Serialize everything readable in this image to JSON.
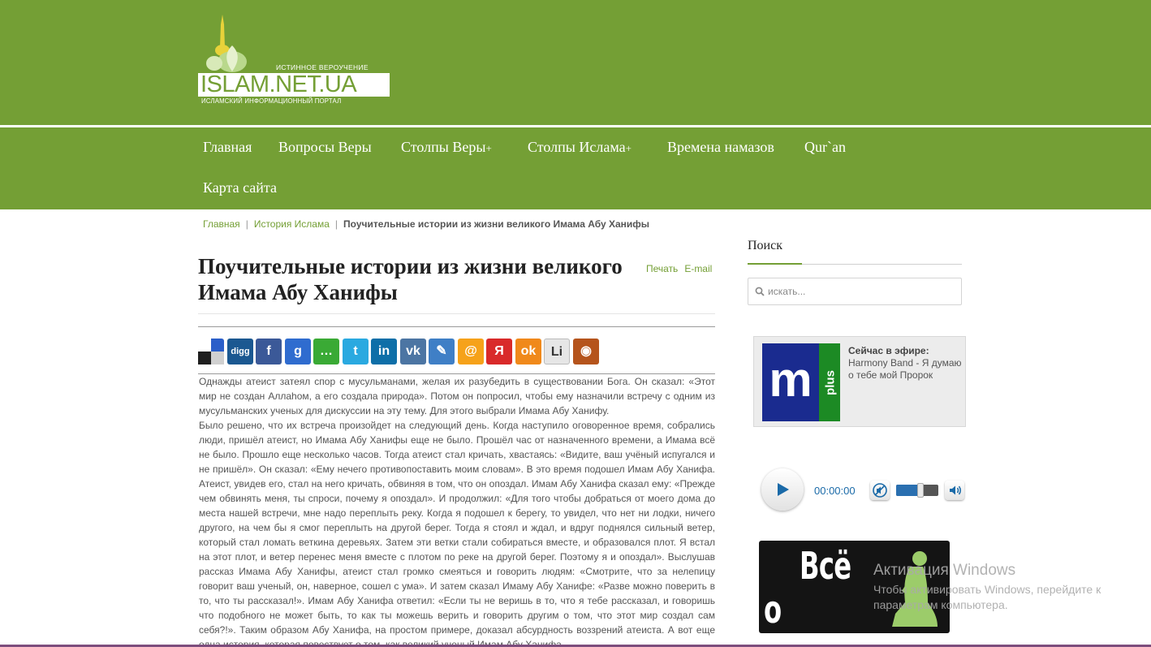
{
  "site": {
    "tagline": "ИСТИННОЕ ВЕРОУЧЕНИЕ",
    "name": "ISLAM.NET.UA",
    "subtitle": "ИСЛАМСКИЙ ИНФОРМАЦИОННЫЙ ПОРТАЛ"
  },
  "nav": {
    "items": [
      {
        "label": "Главная",
        "plus": ""
      },
      {
        "label": "Вопросы Веры",
        "plus": ""
      },
      {
        "label": "Столпы Веры",
        "plus": "+"
      },
      {
        "label": "Столпы Ислама",
        "plus": "+"
      },
      {
        "label": "Времена намазов",
        "plus": ""
      },
      {
        "label": "Qur`an",
        "plus": ""
      },
      {
        "label": "Карта сайта",
        "plus": ""
      }
    ]
  },
  "breadcrumb": {
    "home": "Главная",
    "section": "История Ислама",
    "separator": "|",
    "current": "Поучительные истории из жизни великого Имама Абу Ханифы"
  },
  "article": {
    "title": "Поучительные истории из жизни великого Имама Абу Ханифы",
    "print_label": "Печать",
    "email_label": "E-mail",
    "paragraphs": [
      "Однажды атеист затеял спор с мусульманами, желая их разубедить в существовании Бога. Он сказал: «Этот мир не создан Аллаhом, а его создала природа». Потом он попросил, чтобы ему назначили встречу с одним из мусульманских ученых для дискуссии на эту тему. Для этого выбрали Имама Абу Ханифу.",
      "Было решено, что их встреча произойдет на следующий день. Когда наступило оговоренное время, собрались люди, пришёл атеист, но Имама Абу Ханифы еще не было. Прошёл час от назначенного времени, а Имама всё не было. Прошло еще несколько часов. Тогда атеист стал кричать, хвастаясь: «Видите, ваш учёный испугался и не пришёл». Он сказал: «Ему нечего противопоставить моим словам». В это время подошел Имам Абу Ханифа. Атеист, увидев его, стал на него кричать, обвиняя в том, что он опоздал. Имам Абу Ханифа сказал ему: «Прежде чем обвинять меня, ты спроси, почему я опоздал». И продолжил: «Для того чтобы добраться от моего дома до места нашей встречи, мне надо переплыть реку. Когда я подошел к берегу, то увидел, что нет ни лодки, ничего другого, на чем бы я смог переплыть на другой берег. Тогда я стоял и ждал, и вдруг поднялся сильный ветер, который стал ломать веткина деревьях. Затем эти ветки стали собираться вместе, и образовался плот. Я встал на этот плот, и ветер перенес меня вместе с плотом по реке на другой берег. Поэтому я и опоздал». Выслушав рассказ Имама Абу Ханифы, атеист стал громко смеяться и говорить людям: «Смотрите, что за нелепицу говорит ваш ученый, он, наверное, сошел с ума». И затем сказал Имаму Абу Ханифе: «Разве можно поверить в то, что ты рассказал!». Имам Абу Ханифа ответил: «Если ты не веришь в то, что я тебе рассказал, и говоришь что подобного не может быть, то как ты можешь верить и говорить другим о том, что этот мир создал сам себя?!». Таким образом Абу Ханифа, на простом примере, доказал абсурдность воззрений атеиста. А вот еще одна история, которая повествует о том, как великий ученый Имам Абу Ханифа"
    ]
  },
  "share_icons": [
    {
      "name": "delicious-icon",
      "glyph": "",
      "color": "#1f1f1f"
    },
    {
      "name": "digg-icon",
      "glyph": "digg",
      "color": "#1b5891"
    },
    {
      "name": "facebook-icon",
      "glyph": "f",
      "color": "#3b5998"
    },
    {
      "name": "google-icon",
      "glyph": "g",
      "color": "#2f6ccf"
    },
    {
      "name": "chat-icon",
      "glyph": "…",
      "color": "#3aaa35"
    },
    {
      "name": "twitter-icon",
      "glyph": "t",
      "color": "#2aa9e0"
    },
    {
      "name": "linkedin-icon",
      "glyph": "in",
      "color": "#0e6fa8"
    },
    {
      "name": "vk-icon",
      "glyph": "vk",
      "color": "#4c75a3"
    },
    {
      "name": "pen-icon",
      "glyph": "✎",
      "color": "#3f7fc6"
    },
    {
      "name": "mailru-icon",
      "glyph": "@",
      "color": "#f6a21a"
    },
    {
      "name": "yandex-icon",
      "glyph": "Я",
      "color": "#d92a2a"
    },
    {
      "name": "odnoklassniki-icon",
      "glyph": "ok",
      "color": "#f0891b"
    },
    {
      "name": "liveinternet-icon",
      "glyph": "Li",
      "color": "#e6e6e6"
    },
    {
      "name": "moikrug-icon",
      "glyph": "◉",
      "color": "#b5541c"
    }
  ],
  "sidebar": {
    "search_title": "Поиск",
    "search_placeholder": "искать...",
    "radio": {
      "logo_letter": "m",
      "logo_plus": "plus",
      "now_playing_label": "Сейчас в эфире:",
      "now_playing": "Harmony Band - Я думаю о тебе мой Пророк"
    },
    "player": {
      "time": "00:00:00",
      "volume_fraction": 0.58
    },
    "banner": {
      "line1": "Всё",
      "line2": "о Намазе"
    }
  },
  "watermark": {
    "title": "Активация Windows",
    "text": "Чтобы активировать Windows, перейдите к параметрам компьютера."
  },
  "colors": {
    "brand_green": "#749f35",
    "link_green": "#749f35",
    "player_blue": "#1a6aa8"
  }
}
